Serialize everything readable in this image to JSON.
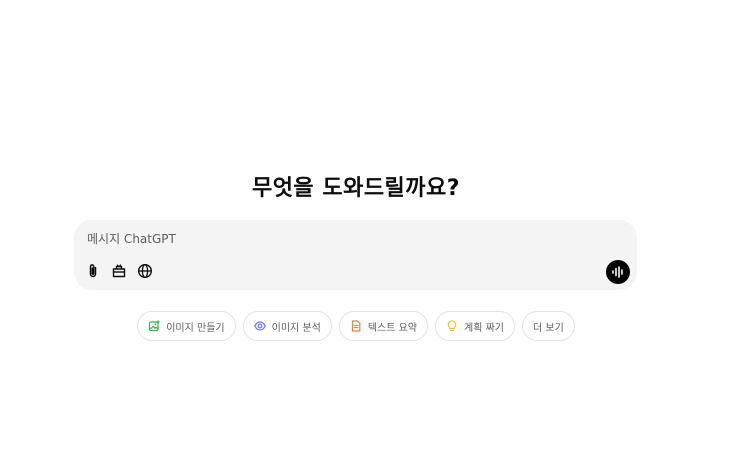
{
  "headline": "무엇을 도와드릴까요?",
  "composer": {
    "placeholder": "메시지 ChatGPT",
    "tools": [
      {
        "icon": "paperclip-icon"
      },
      {
        "icon": "toolbox-icon"
      },
      {
        "icon": "globe-icon"
      }
    ],
    "voice_icon": "voice-waveform-icon"
  },
  "suggestions": [
    {
      "label": "이미지 만들기",
      "icon": "image-create-icon",
      "color": "#35ae47"
    },
    {
      "label": "이미지 분석",
      "icon": "eye-icon",
      "color": "#6c71ff"
    },
    {
      "label": "텍스트 요약",
      "icon": "document-icon",
      "color": "#ea8444"
    },
    {
      "label": "계획 짜기",
      "icon": "lightbulb-icon",
      "color": "#e2c541"
    },
    {
      "label": "더 보기",
      "icon": "",
      "color": ""
    }
  ],
  "colors": {
    "composer_bg": "#f4f4f4",
    "chip_border": "#e3e3e3",
    "text_muted": "#5d5d5d",
    "voice_button": "#000000"
  }
}
